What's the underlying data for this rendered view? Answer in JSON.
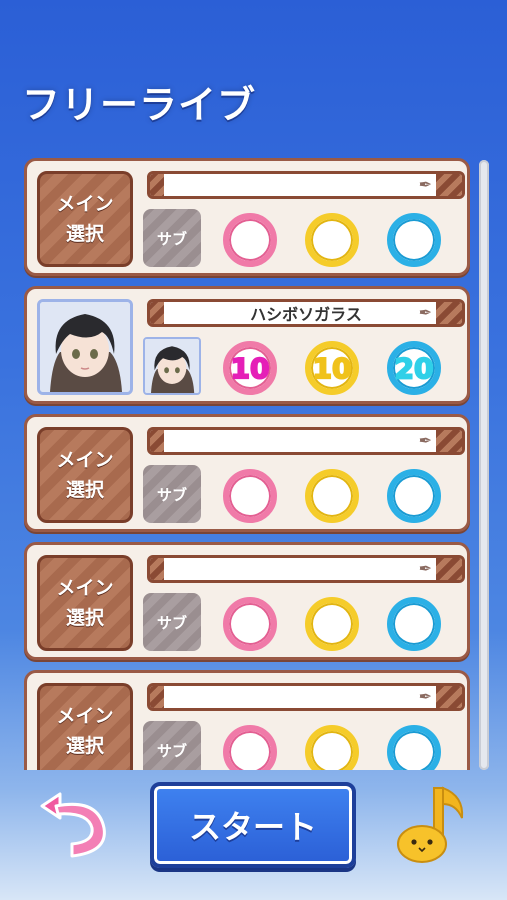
{
  "screen_title": "フリーライブ",
  "cards": [
    {
      "type": "empty",
      "main_label_1": "メイン",
      "main_label_2": "選択",
      "sub_label": "サブ",
      "name": ""
    },
    {
      "type": "filled",
      "name": "ハシボソガラス",
      "values": {
        "pink": "10",
        "yellow": "10",
        "blue": "20"
      }
    },
    {
      "type": "empty",
      "main_label_1": "メイン",
      "main_label_2": "選択",
      "sub_label": "サブ",
      "name": ""
    },
    {
      "type": "empty",
      "main_label_1": "メイン",
      "main_label_2": "選択",
      "sub_label": "サブ",
      "name": ""
    },
    {
      "type": "empty",
      "main_label_1": "メイン",
      "main_label_2": "選択",
      "sub_label": "サブ",
      "name": ""
    }
  ],
  "start_label": "スタート",
  "icons": {
    "back": "back-arrow-icon",
    "music": "music-note-icon",
    "feather": "feather-icon"
  },
  "colors": {
    "pink": "#f07aa8",
    "yellow": "#f5cc2a",
    "blue": "#2bb0e6",
    "brown": "#9a5a46"
  }
}
